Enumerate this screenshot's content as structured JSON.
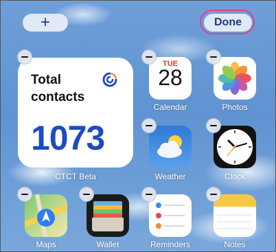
{
  "toolbar": {
    "add_label": "+",
    "done_label": "Done"
  },
  "widget": {
    "title": "Total contacts",
    "value": "1073",
    "label": "CTCT Beta"
  },
  "apps": {
    "calendar": {
      "label": "Calendar",
      "day": "TUE",
      "date": "28"
    },
    "photos": {
      "label": "Photos"
    },
    "weather": {
      "label": "Weather"
    },
    "clock": {
      "label": "Clock"
    },
    "maps": {
      "label": "Maps"
    },
    "wallet": {
      "label": "Wallet"
    },
    "reminders": {
      "label": "Reminders"
    },
    "notes": {
      "label": "Notes"
    }
  },
  "icons": {
    "remove": "minus-circle-icon",
    "widget_logo": "constant-contact-logo-icon"
  },
  "colors": {
    "accent_ring": "#e3418b",
    "widget_number": "#1f4bc0"
  }
}
